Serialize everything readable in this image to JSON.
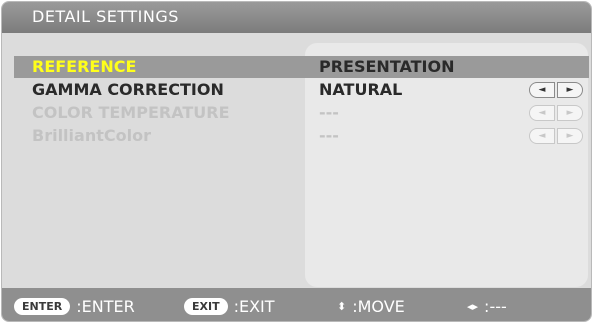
{
  "title": "DETAIL SETTINGS",
  "rows": [
    {
      "label": "REFERENCE",
      "value": "PRESENTATION",
      "state": "selected"
    },
    {
      "label": "GAMMA CORRECTION",
      "value": "NATURAL",
      "state": "normal"
    },
    {
      "label": "COLOR TEMPERATURE",
      "value": "---",
      "state": "disabled"
    },
    {
      "label": "BrilliantColor",
      "value": "---",
      "state": "disabled"
    }
  ],
  "footer": {
    "enter_key": "ENTER",
    "enter_label": ":ENTER",
    "exit_key": "EXIT",
    "exit_label": ":EXIT",
    "move_label": ":MOVE",
    "adjust_label": ":---"
  },
  "icons": {
    "arrow_left": "◄",
    "arrow_right": "►",
    "move": "⬍",
    "adjust": "◂▸"
  },
  "colors": {
    "selected_text": "#ffff1a",
    "selected_bg": "#9a9a9a",
    "title_bar": "#8a8a8a"
  }
}
